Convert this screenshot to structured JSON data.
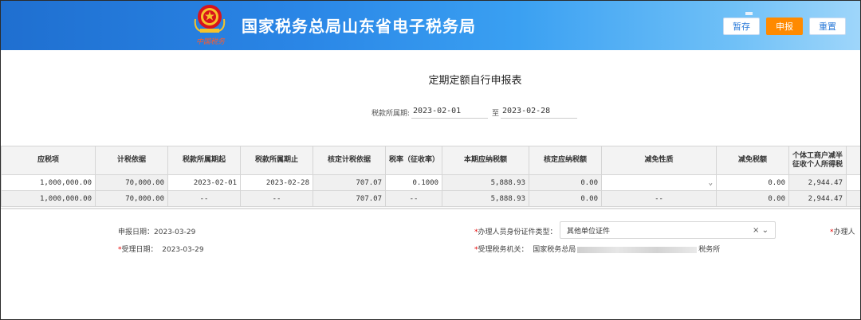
{
  "header": {
    "site_title": "国家税务总局山东省电子税务局",
    "emblem_caption": "中国税务",
    "buttons": {
      "save": "暂存",
      "submit": "申报",
      "reset": "重置"
    },
    "colors": {
      "header_start": "#1f6fd0",
      "header_end": "#9fd6fa",
      "submit_bg": "#ff8a00"
    }
  },
  "form": {
    "title": "定期定额自行申报表",
    "period_label": "税款所属期:",
    "period_start": "2023-02-01",
    "period_to": "至",
    "period_end": "2023-02-28"
  },
  "table": {
    "headers": [
      "应税项",
      "计税依据",
      "税款所属期起",
      "税款所属期止",
      "核定计税依据",
      "税率（征收率）",
      "本期应纳税额",
      "核定应纳税额",
      "减免性质",
      "减免税额",
      "个体工商户减半征收个人所得税",
      ""
    ],
    "rows": [
      [
        "1,000,000.00",
        "70,000.00",
        "2023-02-01",
        "2023-02-28",
        "707.07",
        "0.1000",
        "5,888.93",
        "0.00",
        "",
        "0.00",
        "2,944.47",
        ""
      ],
      [
        "1,000,000.00",
        "70,000.00",
        "--",
        "--",
        "707.07",
        "--",
        "5,888.93",
        "0.00",
        "--",
        "0.00",
        "2,944.47",
        ""
      ]
    ]
  },
  "info": {
    "report_date_label": "申报日期：",
    "report_date": "2023-03-29",
    "accept_date_label": "受理日期：",
    "accept_date": "2023-03-29",
    "id_type_label": "办理人员身份证件类型：",
    "id_type_value": "其他单位证件",
    "authority_label": "受理税务机关：",
    "authority_prefix": "国家税务总局",
    "authority_suffix": "税务所",
    "handler_label": "办理人"
  }
}
